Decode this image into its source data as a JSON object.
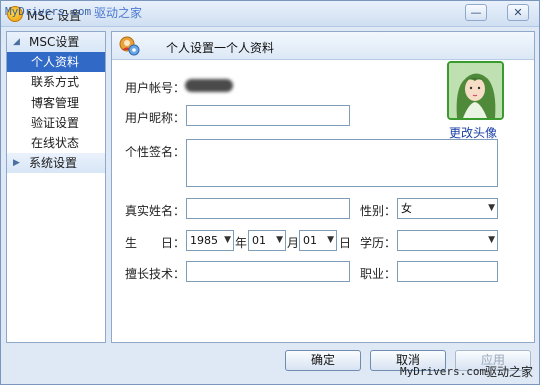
{
  "window": {
    "title": "MSC 设置",
    "minimize_glyph": "—",
    "close_glyph": "✕",
    "watermark_top": "MyDrivers.com",
    "watermark_top_cn": "驱动之家",
    "watermark_bottom": "MyDrivers.com",
    "watermark_bottom_cn": "驱动之家"
  },
  "sidebar": {
    "groups": [
      {
        "label": "MSC设置",
        "arrow": "◢",
        "items": [
          {
            "label": "个人资料",
            "active": true
          },
          {
            "label": "联系方式"
          },
          {
            "label": "博客管理"
          },
          {
            "label": "验证设置"
          },
          {
            "label": "在线状态"
          }
        ]
      },
      {
        "label": "系统设置",
        "arrow": "▶",
        "items": []
      }
    ]
  },
  "panel": {
    "title": "个人设置一个人资料",
    "icon": "user-settings-icon"
  },
  "form": {
    "account_label": "用户帐号：",
    "nickname_label": "用户昵称：",
    "nickname_value": "",
    "signature_label": "个性签名：",
    "signature_value": "",
    "realname_label": "真实姓名：",
    "realname_value": "",
    "gender_label": "性别：",
    "gender_value": "女",
    "birthday_label": "生　　日：",
    "birth_year": "1985",
    "year_unit": "年",
    "birth_month": "01",
    "month_unit": "月",
    "birth_day": "01",
    "day_unit": "日",
    "education_label": "学历：",
    "education_value": "",
    "skills_label": "擅长技术：",
    "skills_value": "",
    "job_label": "职业：",
    "job_value": "",
    "change_avatar": "更改头像"
  },
  "buttons": {
    "ok": "确定",
    "cancel": "取消",
    "apply": "应用"
  },
  "colors": {
    "active_nav": "#3169c6",
    "window_bg": "#dfe9f6",
    "link": "#1a3fa6"
  }
}
